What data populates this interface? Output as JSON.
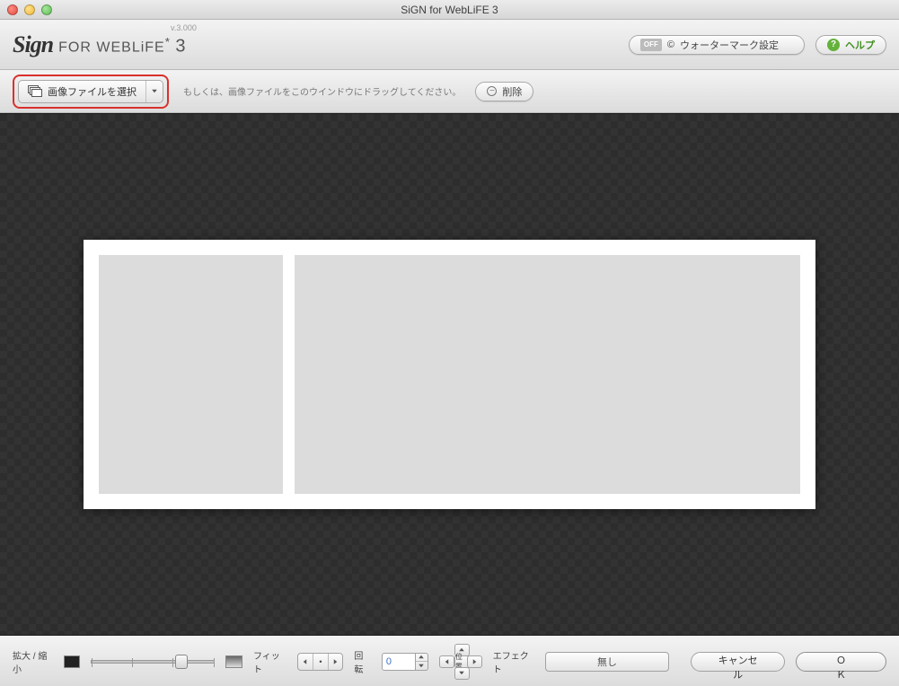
{
  "window": {
    "title": "SiGN for WebLiFE 3"
  },
  "header": {
    "version": "v.3.000",
    "logo_sign": "Sign",
    "logo_for": "FOR WEBLiFE",
    "logo_num": "3",
    "watermark_off": "OFF",
    "watermark_label": "ウォーターマーク設定",
    "help_label": "ヘルプ"
  },
  "file_toolbar": {
    "select_label": "画像ファイルを選択",
    "hint": "もしくは、画像ファイルをこのウインドウにドラッグしてください。",
    "delete_label": "削除"
  },
  "bottom": {
    "zoom_label": "拡大 / 縮小",
    "fit_label": "フィット",
    "rotate_label": "回転",
    "rotate_value": "0",
    "position_label": "位置",
    "effect_label": "エフェクト",
    "effect_value": "無し",
    "cancel_label": "キャンセル",
    "ok_label": "Ｏ Ｋ"
  },
  "colors": {
    "highlight": "#d9302c",
    "help_green": "#64b23a"
  }
}
